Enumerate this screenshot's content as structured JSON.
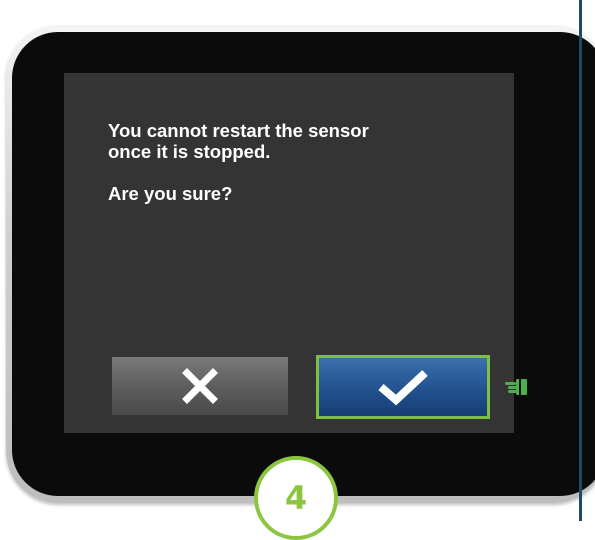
{
  "dialog": {
    "line1": "You cannot restart the sensor",
    "line2": "once it is stopped.",
    "question": "Are you sure?"
  },
  "buttons": {
    "cancel_icon": "x-icon",
    "confirm_icon": "checkmark-icon"
  },
  "indicator": {
    "icon": "tap-hand-icon",
    "color": "#7bc043"
  },
  "step": {
    "number": "4"
  },
  "colors": {
    "accent_green": "#8cc63f",
    "confirm_blue": "#214f8c",
    "screen_bg": "#343434",
    "rule_blue": "#1b4a6b"
  }
}
